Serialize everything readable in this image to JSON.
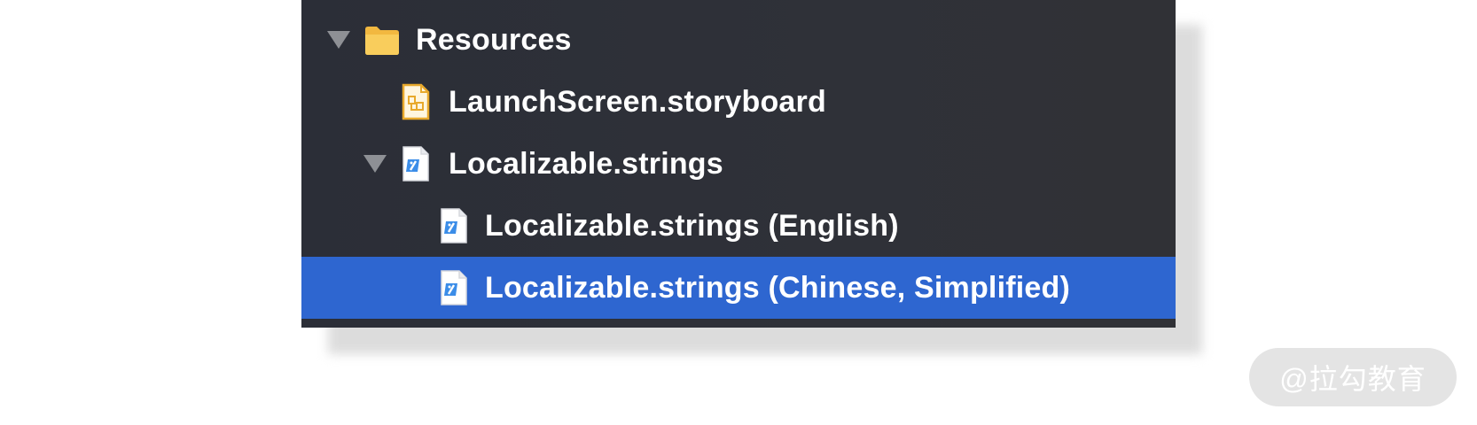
{
  "navigator": {
    "items": [
      {
        "label": "Resources",
        "icon": "folder-icon",
        "expanded": true,
        "level": 0
      },
      {
        "label": "LaunchScreen.storyboard",
        "icon": "storyboard-file-icon",
        "level": 1
      },
      {
        "label": "Localizable.strings",
        "icon": "strings-file-icon",
        "expanded": true,
        "level": 1
      },
      {
        "label": "Localizable.strings (English)",
        "icon": "strings-file-icon",
        "level": 2
      },
      {
        "label": "Localizable.strings (Chinese, Simplified)",
        "icon": "strings-file-icon",
        "level": 2,
        "selected": true
      }
    ]
  },
  "colors": {
    "panel_background": "#2f3138",
    "selection": "#2e66d0",
    "folder": "#f5c24a",
    "storyboard": "#e8a92c",
    "strings_accent": "#3b8de8"
  },
  "watermark": {
    "text": "@拉勾教育"
  }
}
